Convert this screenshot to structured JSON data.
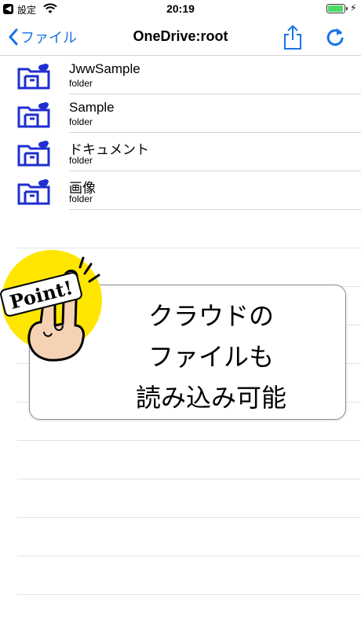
{
  "status_bar": {
    "back_label": "設定",
    "time": "20:19"
  },
  "nav": {
    "back_label": "ファイル",
    "title": "OneDrive:root"
  },
  "files": [
    {
      "name": "JwwSample",
      "kind": "folder"
    },
    {
      "name": "Sample",
      "kind": "folder"
    },
    {
      "name": "ドキュメント",
      "kind": "folder"
    },
    {
      "name": "画像",
      "kind": "folder"
    }
  ],
  "callout": {
    "badge": "Point!",
    "lines": [
      "クラウドの",
      "ファイルも",
      "読み込み可能"
    ]
  },
  "colors": {
    "accent": "#1a73e8",
    "folder_icon": "#1f2fd0",
    "badge_yellow": "#ffe600"
  }
}
